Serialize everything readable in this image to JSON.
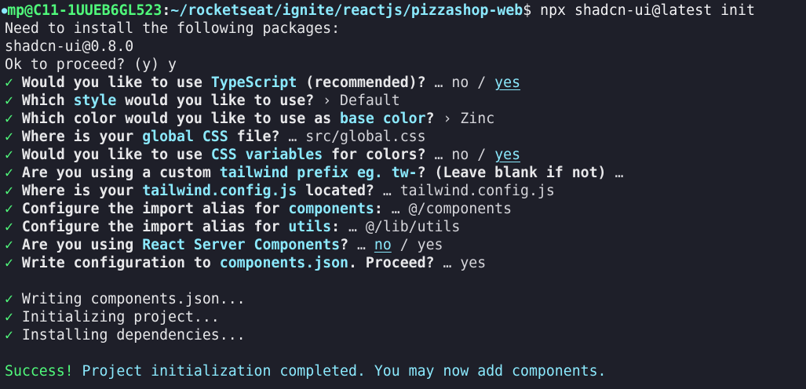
{
  "prompt": {
    "dot": "●",
    "user_host": "mp@C11-1UUEB6GL523",
    "colon": ":",
    "path": "~/rocketseat/ignite/reactjs/pizzashop-web",
    "dollar": "$",
    "command": " npx shadcn-ui@latest init"
  },
  "pre": {
    "l1": "Need to install the following packages:",
    "l2": "shadcn-ui@0.8.0",
    "l3": "Ok to proceed? (y) y"
  },
  "check": "✓",
  "q1": {
    "a": " Would you like to use ",
    "h": "TypeScript",
    "b": " (recommended)? ",
    "r1": "… no / ",
    "r2": "yes"
  },
  "q2": {
    "a": " Which ",
    "h": "style",
    "b": " would you like to use? ",
    "r1": "› Default"
  },
  "q3": {
    "a": " Which color would you like to use as ",
    "h": "base color",
    "b": "? ",
    "r1": "› Zinc"
  },
  "q4": {
    "a": " Where is your ",
    "h": "global CSS",
    "b": " file? ",
    "r1": "… src/global.css"
  },
  "q5": {
    "a": " Would you like to use ",
    "h": "CSS variables",
    "b": " for colors? ",
    "r1": "… no / ",
    "r2": "yes"
  },
  "q6": {
    "a": " Are you using a custom ",
    "h": "tailwind prefix eg. tw-",
    "b": "? (Leave blank if not) ",
    "r1": "…"
  },
  "q7": {
    "a": " Where is your ",
    "h": "tailwind.config.js",
    "b": " located? ",
    "r1": "… tailwind.config.js"
  },
  "q8": {
    "a": " Configure the import alias for ",
    "h": "components",
    "b": ": ",
    "r1": "… @/components"
  },
  "q9": {
    "a": " Configure the import alias for ",
    "h": "utils",
    "b": ": ",
    "r1": "… @/lib/utils"
  },
  "q10": {
    "a": " Are you using ",
    "h": "React Server Components",
    "b": "? ",
    "r1": "… ",
    "r2": "no",
    "r3": " / yes"
  },
  "q11": {
    "a": " Write configuration to ",
    "h": "components.json",
    "b": ". Proceed? ",
    "r1": "… yes"
  },
  "steps": [
    " Writing components.json...",
    " Initializing project...",
    " Installing dependencies..."
  ],
  "success": {
    "label": "Success!",
    "message": " Project initialization completed. You may now add components."
  }
}
